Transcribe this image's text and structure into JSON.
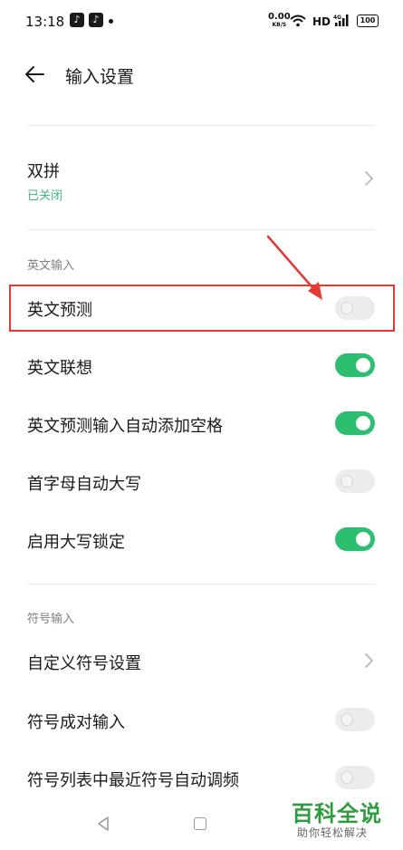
{
  "status_bar": {
    "time": "13:18",
    "net_speed_value": "0.00",
    "net_speed_unit": "KB/S",
    "hd_label": "HD",
    "signal_label": "4G",
    "battery_level": "100"
  },
  "header": {
    "title": "输入设置"
  },
  "shuangpin": {
    "title": "双拼",
    "status": "已关闭"
  },
  "english_section": {
    "header": "英文输入",
    "items": [
      {
        "label": "英文预测",
        "enabled": false
      },
      {
        "label": "英文联想",
        "enabled": true
      },
      {
        "label": "英文预测输入自动添加空格",
        "enabled": true
      },
      {
        "label": "首字母自动大写",
        "enabled": false
      },
      {
        "label": "启用大写锁定",
        "enabled": true
      }
    ]
  },
  "symbol_section": {
    "header": "符号输入",
    "custom_label": "自定义符号设置",
    "items": [
      {
        "label": "符号成对输入",
        "enabled": false
      },
      {
        "label": "符号列表中最近符号自动调频",
        "enabled": false
      }
    ]
  },
  "watermark": {
    "title": "百科全说",
    "subtitle": "助你轻松解决"
  },
  "colors": {
    "toggle_on": "#2dbe6f",
    "toggle_off": "#ececec",
    "status_green": "#3fb97a",
    "highlight_red": "#e53935"
  }
}
